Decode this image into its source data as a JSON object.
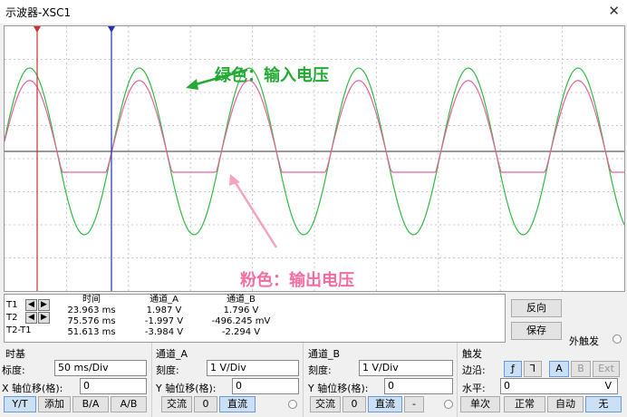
{
  "window": {
    "title": "示波器-XSC1",
    "close_label": "✕"
  },
  "annotations": {
    "green": "绿色：输入电压",
    "pink": "粉色：输出电压"
  },
  "colors": {
    "input": "#33bb44",
    "output": "#e5639b",
    "cursor1": "#d03030",
    "cursor2": "#2030c0"
  },
  "chart_data": {
    "type": "line",
    "series": [
      {
        "name": "绿色：输入电压",
        "kind": "sine",
        "amplitude": 1.0,
        "period": 1.0,
        "phase": 0.0,
        "color": "#33bb44"
      },
      {
        "name": "粉色：输出电压",
        "kind": "clipped-sine",
        "amplitude": 0.85,
        "clip": -0.25,
        "period": 1.0,
        "color": "#e5639b"
      }
    ],
    "cycles": 5.6,
    "grid": true
  },
  "readout": {
    "headers": {
      "time": "时间",
      "cha": "通道_A",
      "chb": "通道_B"
    },
    "rows": [
      {
        "label": "T1",
        "time": "23.963 ms",
        "a": "1.987 V",
        "b": "1.796 V"
      },
      {
        "label": "T2",
        "time": "75.576 ms",
        "a": "-1.997 V",
        "b": "-496.245 mV"
      },
      {
        "label": "T2-T1",
        "time": "51.613 ms",
        "a": "-3.984 V",
        "b": "-2.294 V"
      }
    ],
    "reverse_label": "反向",
    "save_label": "保存",
    "ext_trigger_label": "外触发"
  },
  "timebase": {
    "title": "时基",
    "scale_label": "标度:",
    "scale_value": "50 ms/Div",
    "xpos_label": "X 轴位移(格):",
    "xpos_value": "0",
    "buttons": [
      "Y/T",
      "添加",
      "B/A",
      "A/B"
    ]
  },
  "channel_a": {
    "title": "通道_A",
    "scale_label": "刻度:",
    "scale_value": "1 V/Div",
    "ypos_label": "Y 轴位移(格):",
    "ypos_value": "0",
    "ac": "交流",
    "zero": "0",
    "dc": "直流"
  },
  "channel_b": {
    "title": "通道_B",
    "scale_label": "刻度:",
    "scale_value": "1 V/Div",
    "ypos_label": "Y 轴位移(格):",
    "ypos_value": "0",
    "ac": "交流",
    "zero": "0",
    "dc": "直流",
    "minus": "-"
  },
  "trigger": {
    "title": "触发",
    "edge_label": "边沿:",
    "edge_rise": "ƒ",
    "edge_fall": "⅂",
    "src_a": "A",
    "src_b": "B",
    "src_ext": "Ext",
    "level_label": "水平:",
    "level_value": "0",
    "level_unit": "V",
    "modes": [
      "单次",
      "正常",
      "自动",
      "无"
    ]
  }
}
